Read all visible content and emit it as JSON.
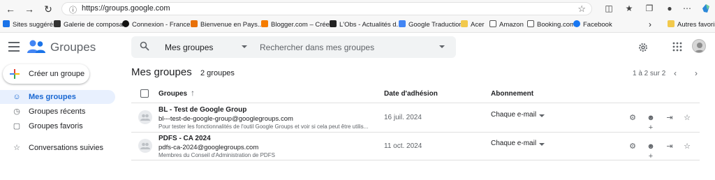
{
  "browser": {
    "url": "https://groups.google.com"
  },
  "bookmarks": [
    {
      "label": "Sites suggérés",
      "color": "#1a73e8"
    },
    {
      "label": "Galerie de composa...",
      "color": "#333333"
    },
    {
      "label": "Connexion - France tv",
      "color": "#111111"
    },
    {
      "label": "Bienvenue en Pays...",
      "color": "#e8710a"
    },
    {
      "label": "Blogger.com – Crée...",
      "color": "#f57c00"
    },
    {
      "label": "L'Obs - Actualités d...",
      "color": "#222222"
    },
    {
      "label": "Google Traduction",
      "color": "#4285f4"
    },
    {
      "label": "Acer",
      "color": "#f2c94c"
    },
    {
      "label": "Amazon",
      "color": "#ffffff"
    },
    {
      "label": "Booking.com",
      "color": "#ffffff"
    },
    {
      "label": "Facebook",
      "color": "#1877f2"
    },
    {
      "label": "Autres favoris",
      "color": "#f2c94c"
    }
  ],
  "app": {
    "title": "Groupes",
    "search_scope": "Mes groupes",
    "search_placeholder": "Rechercher dans mes groupes"
  },
  "sidebar": {
    "create_label": "Créer un groupe",
    "items": [
      {
        "label": "Mes groupes",
        "icon": "people-icon",
        "active": true
      },
      {
        "label": "Groupes récents",
        "icon": "clock-icon",
        "active": false
      },
      {
        "label": "Groupes favoris",
        "icon": "folder-star-icon",
        "active": false
      },
      {
        "label": "Conversations suivies",
        "icon": "star-icon",
        "active": false
      }
    ]
  },
  "main": {
    "title": "Mes groupes",
    "count": "2 groupes",
    "pagination": "1 à 2 sur 2",
    "columns": {
      "groups": "Groupes",
      "date": "Date d'adhésion",
      "subscription": "Abonnement"
    },
    "rows": [
      {
        "name": "BL - Test de Google Group",
        "email": "bl---test-de-google-group@googlegroups.com",
        "description": "Pour tester les fonctionnalités de l'outil Google Groups et voir si cela peut être utilis...",
        "date": "16 juil. 2024",
        "subscription": "Chaque e-mail"
      },
      {
        "name": "PDFS - CA 2024",
        "email": "pdfs-ca-2024@googlegroups.com",
        "description": "Membres du Conseil d'Administration de PDFS",
        "date": "11 oct. 2024",
        "subscription": "Chaque e-mail"
      }
    ]
  },
  "colors": {
    "accent": "#1967d2",
    "active_bg": "#e8f0fe"
  }
}
